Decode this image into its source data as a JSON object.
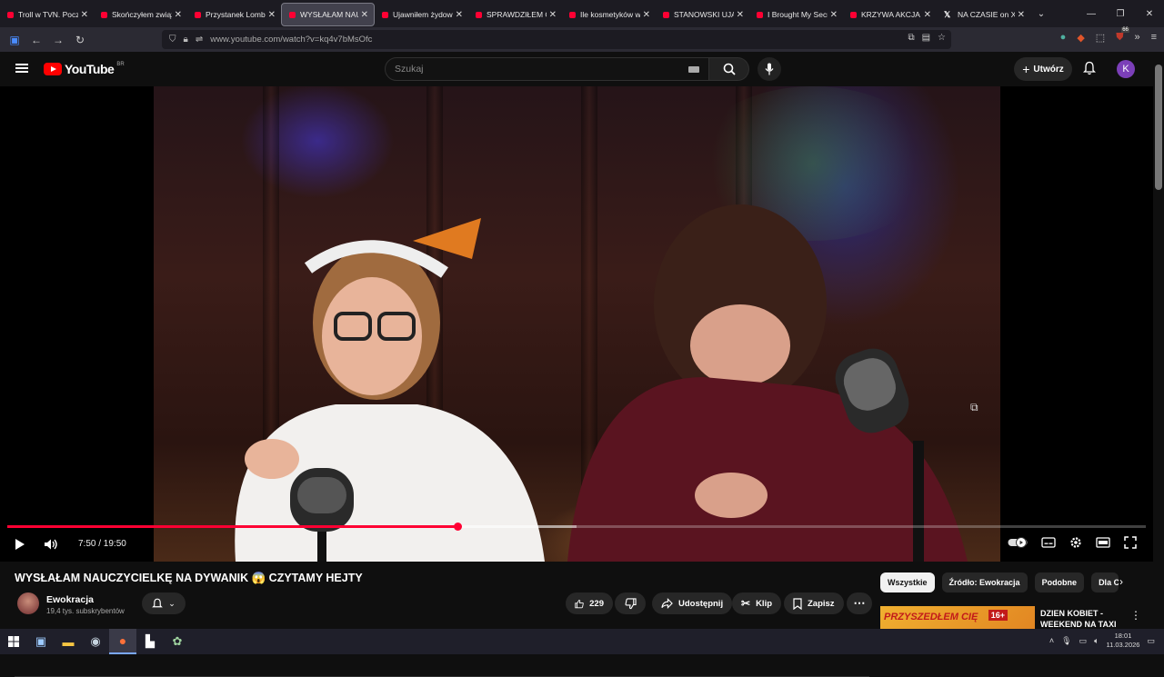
{
  "browser": {
    "tabs": [
      {
        "label": "Troll w TVN. Poczw",
        "favicon": "youtube-icon"
      },
      {
        "label": "Skończyłem związ",
        "favicon": "youtube-icon"
      },
      {
        "label": "Przystanek Lomba",
        "favicon": "youtube-icon"
      },
      {
        "label": "WYSŁAŁAM NAUC",
        "favicon": "youtube-icon",
        "active": true
      },
      {
        "label": "Ujawniłem żydow",
        "favicon": "youtube-icon"
      },
      {
        "label": "SPRAWDZIŁEM CZ",
        "favicon": "youtube-icon"
      },
      {
        "label": "Ile kosmetyków w",
        "favicon": "youtube-icon"
      },
      {
        "label": "STANOWSKI UJAW",
        "favicon": "youtube-icon"
      },
      {
        "label": "I Brought My Secr",
        "favicon": "youtube-icon"
      },
      {
        "label": "KRZYWA AKCJA #",
        "favicon": "youtube-icon"
      },
      {
        "label": "NA CZASIE on X: '",
        "favicon": "x-icon"
      }
    ],
    "tab_close": "✕",
    "url": "www.youtube.com/watch?v=kq4v7bMsOfc",
    "extension_badge": "66"
  },
  "youtube": {
    "logo_text": "YouTube",
    "country_code": "BR",
    "search_placeholder": "Szukaj",
    "create_label": "Utwórz",
    "avatar_letter": "K",
    "player": {
      "current_time": "7:50",
      "duration": "19:50",
      "time_display": "7:50 / 19:50",
      "progress_fraction": 0.395,
      "buffered_fraction": 0.5
    },
    "video": {
      "title": "WYSŁAŁAM NAUCZYCIELKĘ NA DYWANIK 😱 CZYTAMY HEJTY",
      "channel_name": "Ewokracja",
      "subscribers": "19,4 tys. subskrybentów",
      "likes": "229",
      "share_label": "Udostępnij",
      "clip_label": "Klip",
      "save_label": "Zapisz"
    },
    "chips": [
      "Wszystkie",
      "Źródło: Ewokracja",
      "Podobne",
      "Dla C"
    ],
    "recommendation": {
      "title": "DZIEN KOBIET - WEEKEND NA TAXI",
      "thumb_text": "PRZYSZEDŁEM CIĘ",
      "age_badge": "16+"
    }
  },
  "taskbar": {
    "time": "18:01",
    "date": "11.03.2026"
  }
}
